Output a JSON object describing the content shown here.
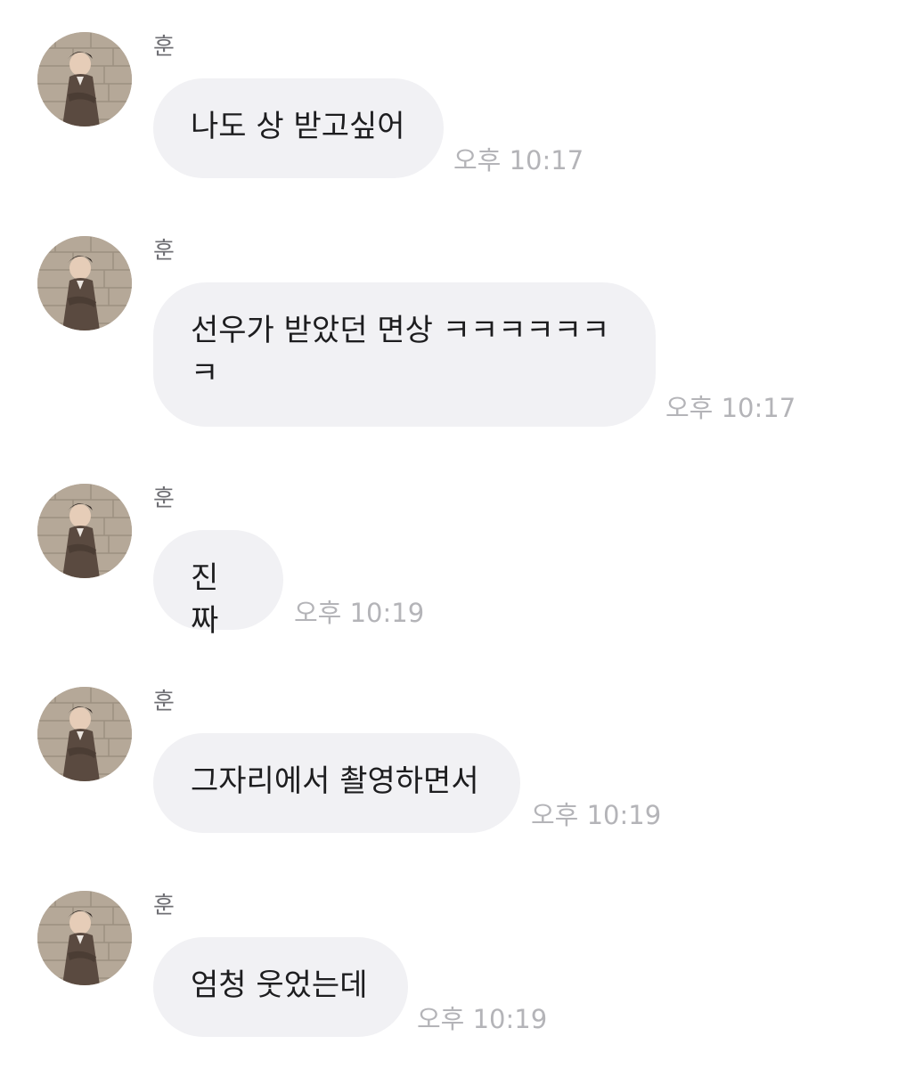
{
  "messages": [
    {
      "sender": "훈",
      "text": "나도 상 받고싶어",
      "time": "오후 10:17"
    },
    {
      "sender": "훈",
      "text": "선우가 받았던 면상 ㅋㅋㅋㅋㅋㅋ\nㅋ",
      "time": "오후 10:17"
    },
    {
      "sender": "훈",
      "text": "진짜",
      "time": "오후 10:19"
    },
    {
      "sender": "훈",
      "text": "그자리에서 촬영하면서",
      "time": "오후 10:19"
    },
    {
      "sender": "훈",
      "text": "엄청 웃었는데",
      "time": "오후 10:19"
    }
  ],
  "colors": {
    "bubble": "#f1f1f4",
    "text": "#1d1d1f",
    "sender": "#6f6f74",
    "time": "#b4b4b8",
    "background": "#ffffff"
  },
  "icons": {
    "avatar": "profile-photo-avatar"
  }
}
